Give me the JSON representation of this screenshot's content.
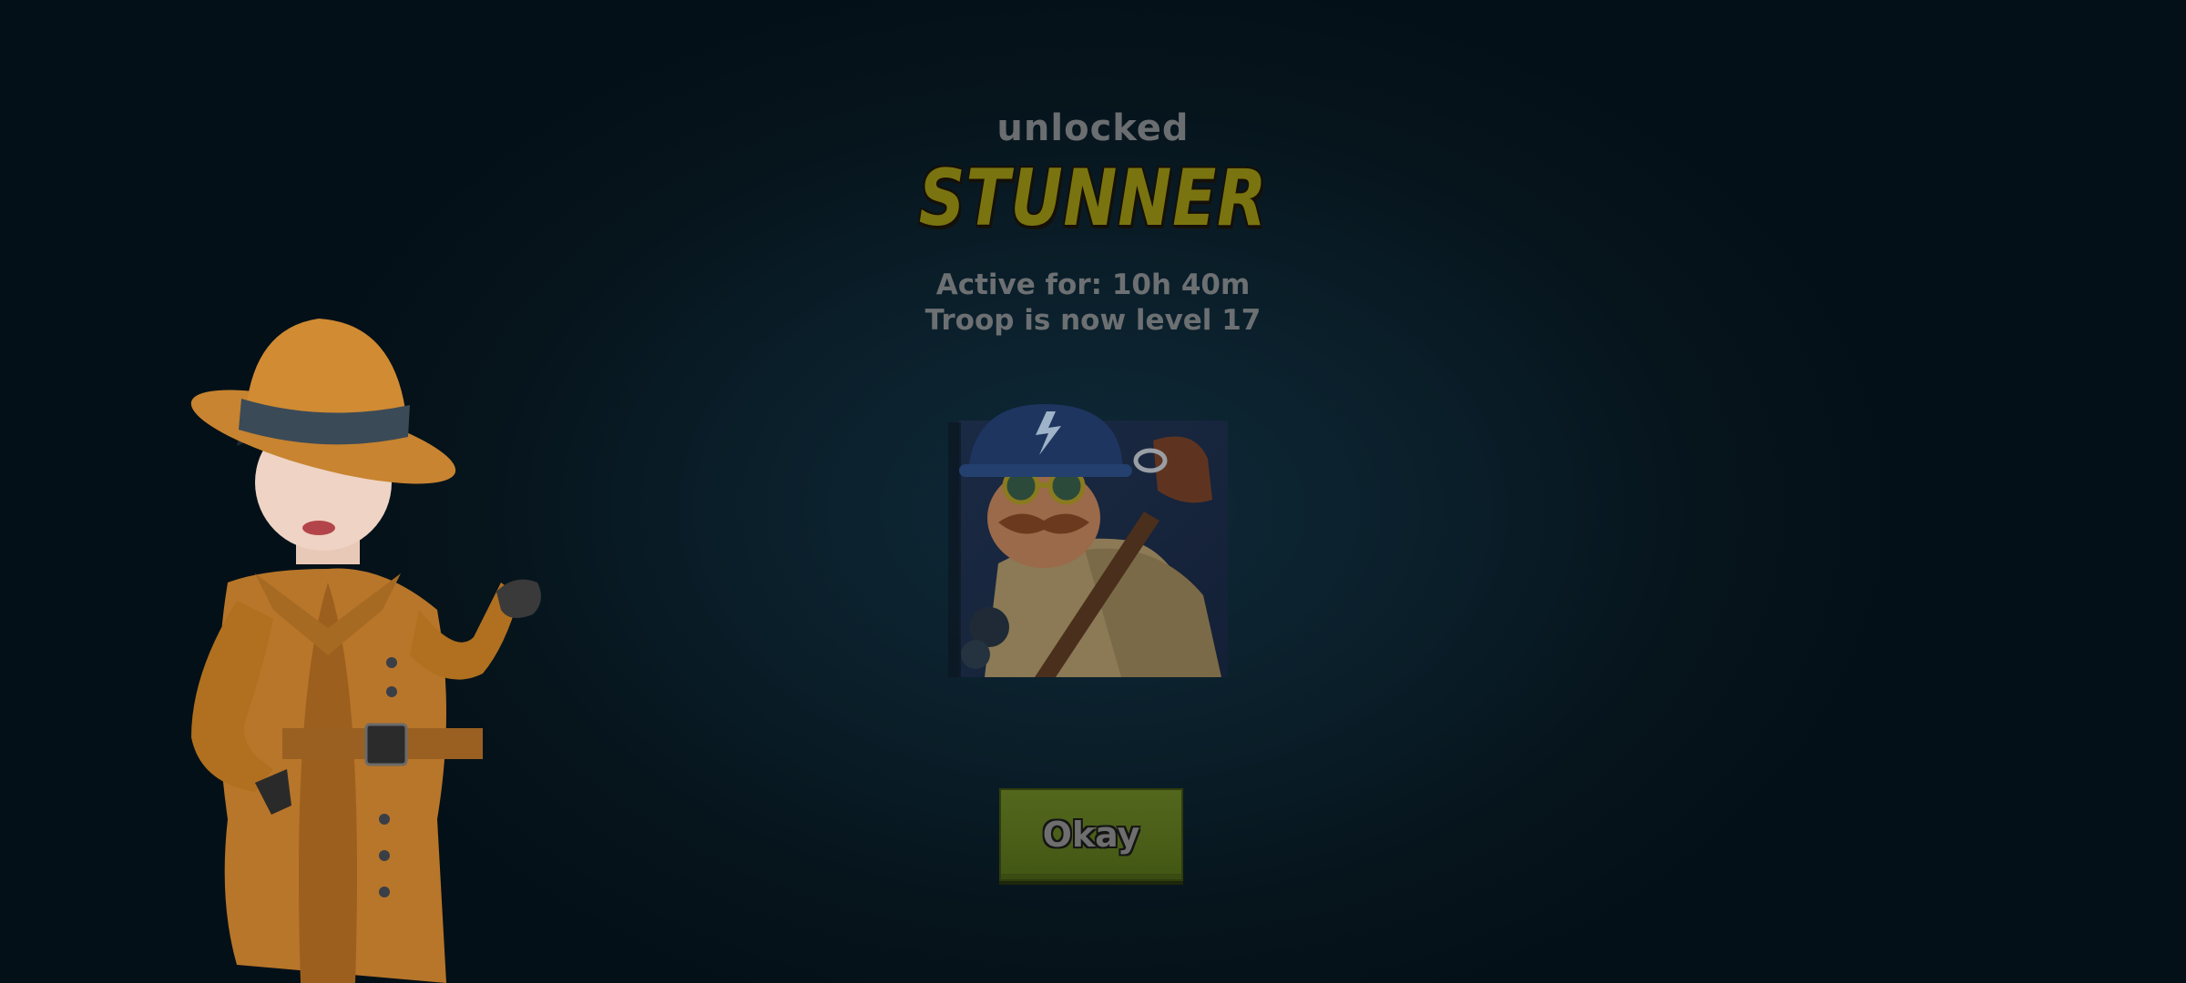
{
  "popup": {
    "subtitle": "unlocked",
    "troop_name": "STUNNER",
    "active_for": "Active for: 10h 40m",
    "level_text": "Troop is now level 17",
    "okay_label": "Okay"
  },
  "icons": {
    "troop_portrait": "stunner-portrait-icon",
    "advisor": "detective-advisor-character"
  },
  "colors": {
    "troop_name": "#7a7410",
    "button": "#4a5e18",
    "text": "#6d7072",
    "background": "#0a1e29"
  }
}
